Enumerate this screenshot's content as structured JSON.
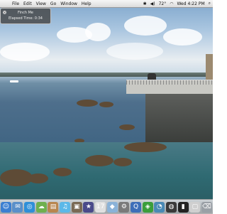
{
  "menubar": {
    "apple": "",
    "menus": [
      "File",
      "Edit",
      "View",
      "Go",
      "Window",
      "Help"
    ],
    "status": {
      "battery": "72°",
      "clock": "Wed 4:22 PM"
    }
  },
  "hud": {
    "title": "Finch Me",
    "elapsed": "Elapsed Time: 0:34"
  },
  "dock": {
    "items": [
      {
        "name": "finder-icon",
        "glyph": "☺",
        "color": "#3b7fd1"
      },
      {
        "name": "mail-icon",
        "glyph": "✉",
        "color": "#5a8fc9"
      },
      {
        "name": "safari-icon",
        "glyph": "◎",
        "color": "#2f8fd8"
      },
      {
        "name": "ichat-icon",
        "glyph": "☁",
        "color": "#6fb04e"
      },
      {
        "name": "address-book-icon",
        "glyph": "▤",
        "color": "#b8864f"
      },
      {
        "name": "itunes-icon",
        "glyph": "♫",
        "color": "#5bb8e8"
      },
      {
        "name": "iphoto-icon",
        "glyph": "▣",
        "color": "#7a6a55"
      },
      {
        "name": "imovie-icon",
        "glyph": "★",
        "color": "#4a4a8a"
      },
      {
        "name": "ical-icon",
        "glyph": "17",
        "color": "#e0e0e0"
      },
      {
        "name": "preview-icon",
        "glyph": "◆",
        "color": "#8ab2d8"
      },
      {
        "name": "system-preferences-icon",
        "glyph": "⚙",
        "color": "#7a7a7a"
      },
      {
        "name": "quicktime-icon",
        "glyph": "Q",
        "color": "#3d6fb8"
      },
      {
        "name": "app-store-icon",
        "glyph": "◈",
        "color": "#3b9e3b"
      },
      {
        "name": "time-machine-icon",
        "glyph": "◔",
        "color": "#4a8ab5"
      },
      {
        "name": "dashboard-icon",
        "glyph": "◍",
        "color": "#3a3a3a"
      },
      {
        "name": "terminal-icon",
        "glyph": "▮",
        "color": "#222222"
      },
      {
        "name": "widget-icon",
        "glyph": "▢",
        "color": "#cfcfcf"
      },
      {
        "name": "trash-icon",
        "glyph": "⌫",
        "color": "#9aa0a6"
      }
    ]
  }
}
